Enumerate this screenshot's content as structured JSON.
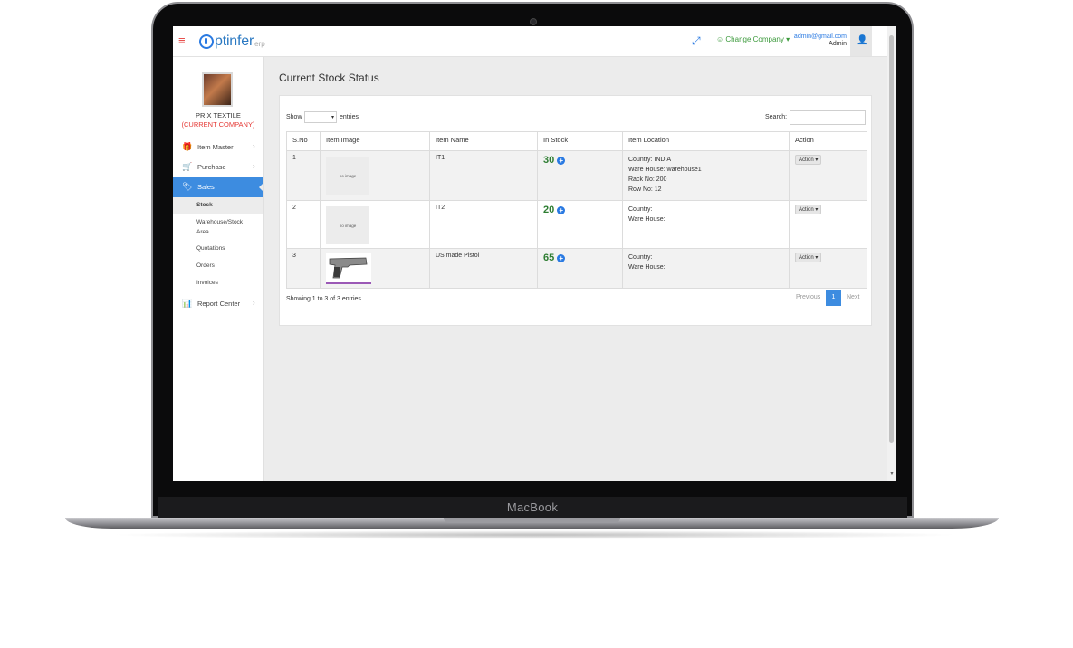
{
  "device": {
    "brand": "MacBook"
  },
  "topbar": {
    "menu_icon": "hamburger-icon",
    "logo_text": "ptinfer",
    "logo_sub": "erp",
    "change_company": "☺ Change Company ▾",
    "user_email": "admin@gmail.com",
    "user_role": "Admin"
  },
  "sidebar": {
    "company_name": "PRIX TEXTILE",
    "company_current": "(CURRENT COMPANY)",
    "items": [
      {
        "label": "Item Master",
        "icon": "gift-icon"
      },
      {
        "label": "Purchase",
        "icon": "cart-icon"
      },
      {
        "label": "Sales",
        "icon": "tags-icon"
      }
    ],
    "sub_items": [
      {
        "label": "Stock"
      },
      {
        "label": "Warehouse/Stock"
      },
      {
        "label": "Area"
      },
      {
        "label": "Quotations"
      },
      {
        "label": "Orders"
      },
      {
        "label": "Invoices"
      }
    ],
    "report": {
      "label": "Report Center",
      "icon": "chart-icon"
    }
  },
  "main": {
    "title": "Current Stock Status",
    "show_label": "Show",
    "entries_label": "entries",
    "search_label": "Search:",
    "columns": [
      "S.No",
      "Item Image",
      "Item Name",
      "In Stock",
      "Item Location",
      "Action"
    ],
    "rows": [
      {
        "sno": "1",
        "image": "no image",
        "name": "IT1",
        "stock": "30",
        "loc1": "Country: INDIA",
        "loc2": "Ware House: warehouse1",
        "loc3": "Rack No: 200",
        "loc4": "Row No: 12",
        "action": "Action ▾"
      },
      {
        "sno": "2",
        "image": "no image",
        "name": "IT2",
        "stock": "20",
        "loc1": "Country:",
        "loc2": "Ware House:",
        "loc3": "",
        "loc4": "",
        "action": "Action ▾"
      },
      {
        "sno": "3",
        "image": "pistol-photo",
        "name": "US made Pistol",
        "stock": "65",
        "loc1": "Country:",
        "loc2": "Ware House:",
        "loc3": "",
        "loc4": "",
        "action": "Action ▾"
      }
    ],
    "showing": "Showing 1 to 3 of 3 entries",
    "pager": {
      "prev": "Previous",
      "page": "1",
      "next": "Next"
    }
  }
}
